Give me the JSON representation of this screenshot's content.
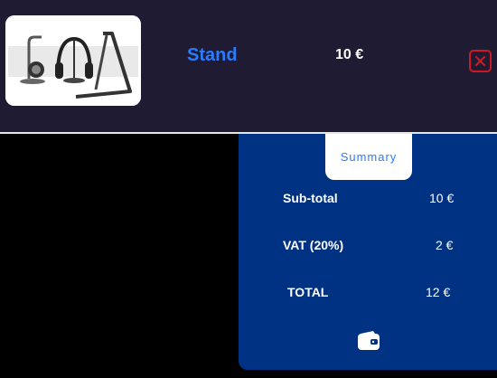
{
  "cart": {
    "item": {
      "name": "Stand",
      "price": "10 €",
      "image_alt": "Headphone stand product photo"
    },
    "remove_icon": "close-icon"
  },
  "summary": {
    "tab_label": "Summary",
    "rows": [
      {
        "label": "Sub-total",
        "value": "10 €"
      },
      {
        "label": "VAT (20%)",
        "value": "2 €"
      },
      {
        "label": "TOTAL",
        "value": "12 €"
      }
    ],
    "wallet_icon": "wallet-icon"
  },
  "colors": {
    "header_bg": "#1e1b33",
    "accent_blue": "#2b7bff",
    "summary_bg": "#003283",
    "remove_red": "#d01722"
  }
}
